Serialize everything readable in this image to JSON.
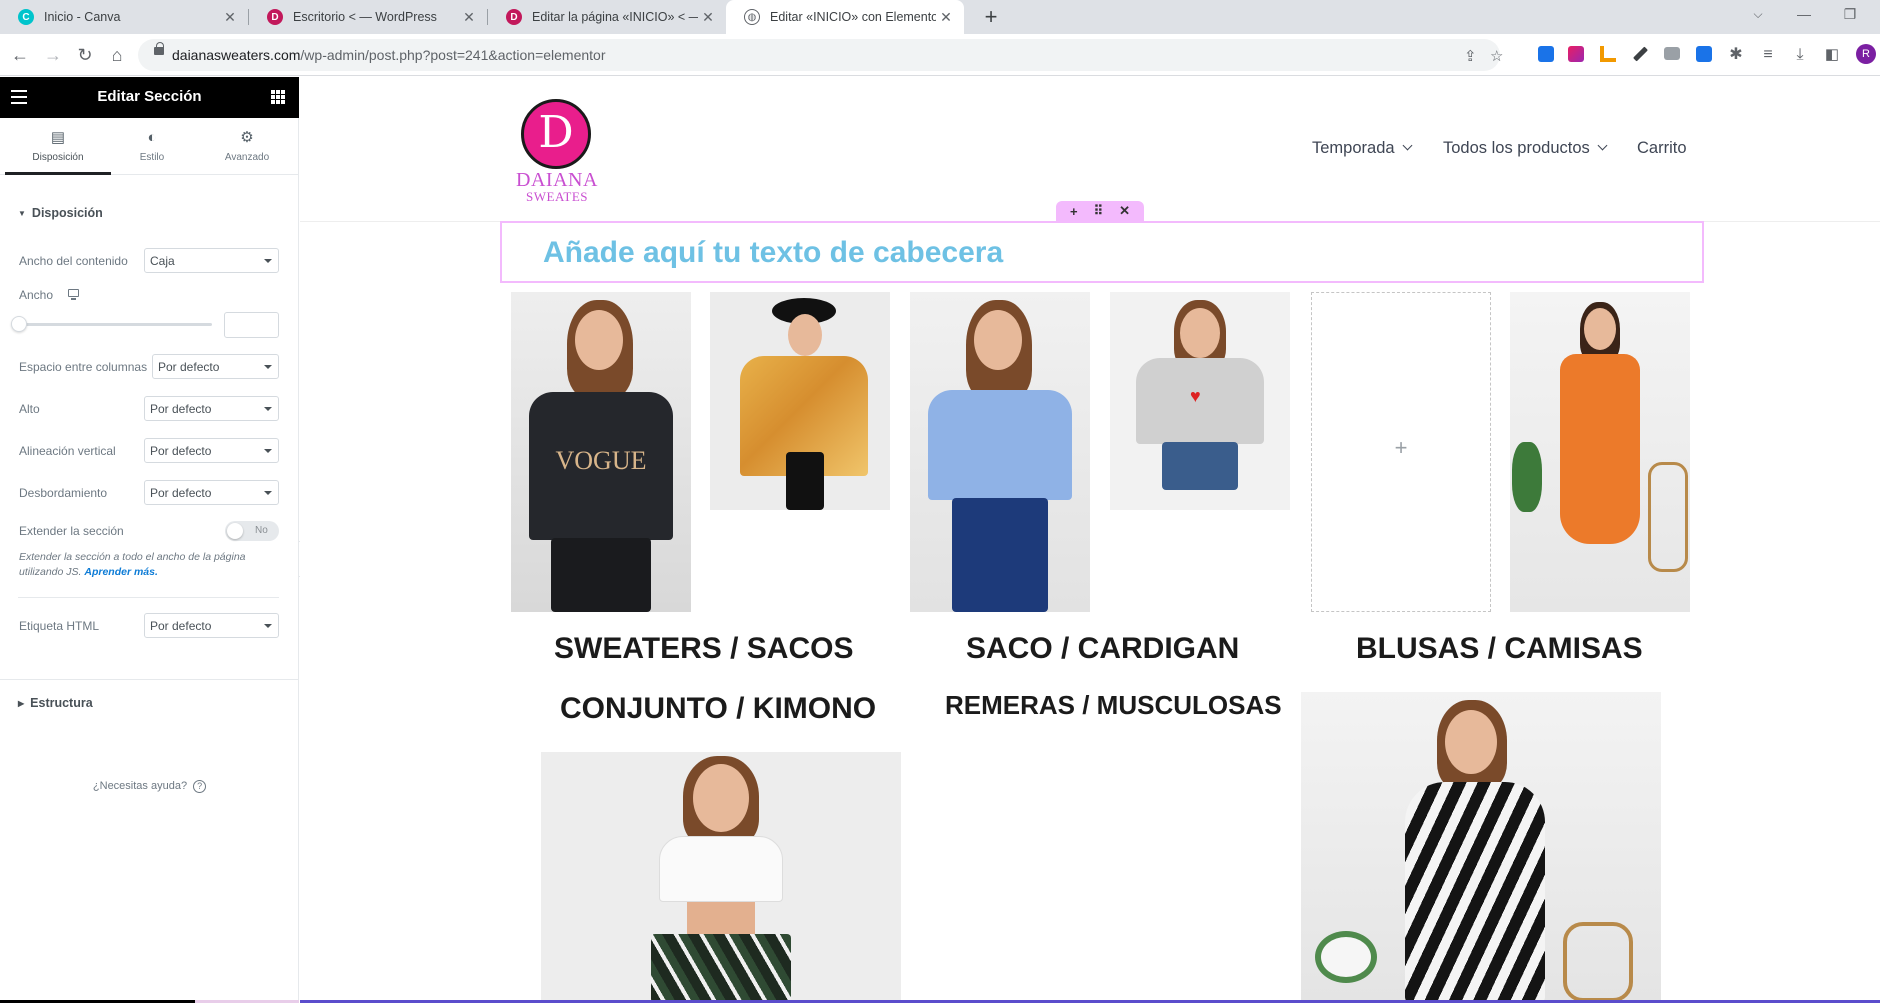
{
  "browser": {
    "tabs": [
      {
        "title": "Inicio - Canva",
        "favicon": "canva-icon",
        "active": false
      },
      {
        "title": "Escritorio < — WordPress",
        "favicon": "wordpress-icon",
        "active": false
      },
      {
        "title": "Editar la página «INICIO» < — WordP",
        "favicon": "wordpress-icon",
        "active": false
      },
      {
        "title": "Editar «INICIO» con Elementor",
        "favicon": "globe-icon",
        "active": true
      }
    ],
    "new_tab": "+",
    "url_host": "daianasweaters.com",
    "url_path": "/wp-admin/post.php?post=241&action=elementor",
    "profile_initial": "R"
  },
  "panel": {
    "title": "Editar Sección",
    "tabs": [
      "Disposición",
      "Estilo",
      "Avanzado"
    ],
    "section_title": "Disposición",
    "controls": {
      "content_width": {
        "label": "Ancho del contenido",
        "value": "Caja"
      },
      "width": {
        "label": "Ancho"
      },
      "column_gap": {
        "label": "Espacio entre columnas",
        "value": "Por defecto"
      },
      "height": {
        "label": "Alto",
        "value": "Por defecto"
      },
      "vertical_align": {
        "label": "Alineación vertical",
        "value": "Por defecto"
      },
      "overflow": {
        "label": "Desbordamiento",
        "value": "Por defecto"
      },
      "stretch": {
        "label": "Extender la sección",
        "toggle": "No"
      },
      "html_tag": {
        "label": "Etiqueta HTML",
        "value": "Por defecto"
      }
    },
    "stretch_description": "Extender la sección a todo el ancho de la página utilizando JS.",
    "stretch_link": "Aprender más.",
    "structure_title": "Estructura",
    "help_text": "¿Necesitas ayuda?"
  },
  "site": {
    "logo_letter": "D",
    "logo_line1": "DAIANA",
    "logo_line2": "SWEATES",
    "nav": [
      "Temporada",
      "Todos los productos",
      "Carrito"
    ],
    "hero_title": "Añade aquí tu texto de cabecera",
    "categories": [
      "SWEATERS / SACOS",
      "SACO / CARDIGAN",
      "BLUSAS / CAMISAS",
      "CONJUNTO / KIMONO",
      "REMERAS / MUSCULOSAS"
    ],
    "add_widget": "+"
  },
  "colors": {
    "accent_title": "#6ec1e4",
    "section_outline": "#f3bafd",
    "logo_pink": "#e91e8c",
    "logo_text": "#c94fd1"
  }
}
